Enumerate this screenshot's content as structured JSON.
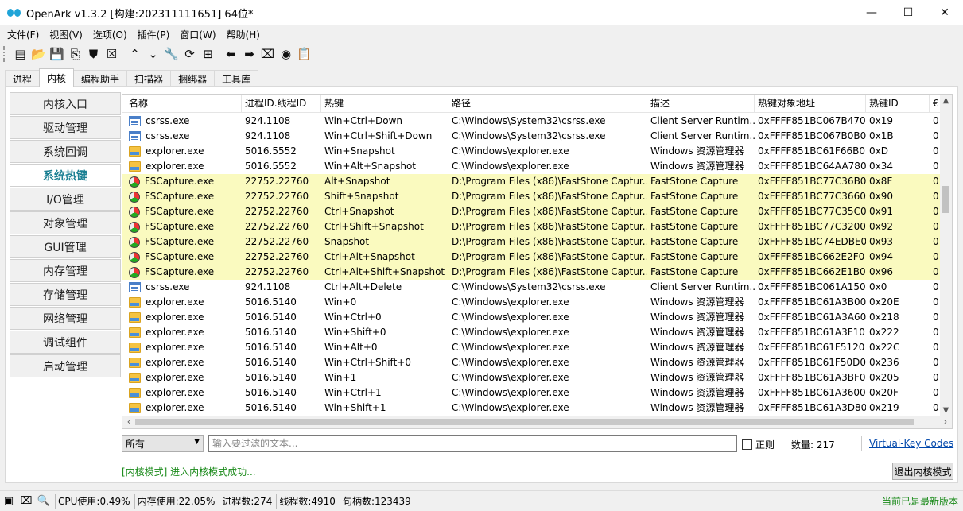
{
  "window": {
    "title": "OpenArk v1.3.2 [构建:202311111651]  64位*",
    "controls": [
      "—",
      "☐",
      "✕"
    ]
  },
  "menu": [
    "文件(F)",
    "视图(V)",
    "选项(O)",
    "插件(P)",
    "窗口(W)",
    "帮助(H)"
  ],
  "toolbar": [
    {
      "name": "console-icon",
      "glyph": "▤"
    },
    {
      "name": "folder-open-icon",
      "glyph": "📂"
    },
    {
      "name": "save-icon",
      "glyph": "💾"
    },
    {
      "name": "export-icon",
      "glyph": "⎘"
    },
    {
      "name": "shield-icon",
      "glyph": "⛊"
    },
    {
      "name": "kill-icon",
      "glyph": "☒"
    },
    {
      "name": "chevron-up-icon",
      "glyph": "⌃"
    },
    {
      "name": "chevron-down-icon",
      "glyph": "⌄"
    },
    {
      "name": "wrench-icon",
      "glyph": "🔧"
    },
    {
      "name": "refresh-icon",
      "glyph": "⟳"
    },
    {
      "name": "grid-icon",
      "glyph": "⊞"
    },
    {
      "name": "arrow-left-icon",
      "glyph": "⬅"
    },
    {
      "name": "arrow-right-icon",
      "glyph": "➡"
    },
    {
      "name": "map-icon",
      "glyph": "⌧"
    },
    {
      "name": "github-icon",
      "glyph": "◉"
    },
    {
      "name": "clipboard-icon",
      "glyph": "📋"
    }
  ],
  "tabs": [
    "进程",
    "内核",
    "编程助手",
    "扫描器",
    "捆绑器",
    "工具库"
  ],
  "active_tab": 1,
  "sidenav": [
    "内核入口",
    "驱动管理",
    "系统回调",
    "系统热键",
    "I/O管理",
    "对象管理",
    "GUI管理",
    "内存管理",
    "存储管理",
    "网络管理",
    "调试组件",
    "启动管理"
  ],
  "active_nav": 3,
  "table": {
    "columns": [
      "名称",
      "进程ID.线程ID",
      "热键",
      "路径",
      "描述",
      "热键对象地址",
      "热键ID",
      "€"
    ],
    "rows": [
      {
        "icon": "win",
        "hl": false,
        "c": [
          "csrss.exe",
          "924.1108",
          "Win+Ctrl+Down",
          "C:\\Windows\\System32\\csrss.exe",
          "Client Server Runtim...",
          "0xFFFF851BC067B470",
          "0x19",
          "0"
        ]
      },
      {
        "icon": "win",
        "hl": false,
        "c": [
          "csrss.exe",
          "924.1108",
          "Win+Ctrl+Shift+Down",
          "C:\\Windows\\System32\\csrss.exe",
          "Client Server Runtim...",
          "0xFFFF851BC067B0B0",
          "0x1B",
          "0"
        ]
      },
      {
        "icon": "folder",
        "hl": false,
        "c": [
          "explorer.exe",
          "5016.5552",
          "Win+Snapshot",
          "C:\\Windows\\explorer.exe",
          "Windows 资源管理器",
          "0xFFFF851BC61F66B0",
          "0xD",
          "0"
        ]
      },
      {
        "icon": "folder",
        "hl": false,
        "c": [
          "explorer.exe",
          "5016.5552",
          "Win+Alt+Snapshot",
          "C:\\Windows\\explorer.exe",
          "Windows 资源管理器",
          "0xFFFF851BC64AA780",
          "0x34",
          "0"
        ]
      },
      {
        "icon": "fs",
        "hl": true,
        "c": [
          "FSCapture.exe",
          "22752.22760",
          "Alt+Snapshot",
          "D:\\Program Files (x86)\\FastStone Captur...",
          "FastStone Capture",
          "0xFFFF851BC77C36B0",
          "0x8F",
          "0"
        ]
      },
      {
        "icon": "fs",
        "hl": true,
        "c": [
          "FSCapture.exe",
          "22752.22760",
          "Shift+Snapshot",
          "D:\\Program Files (x86)\\FastStone Captur...",
          "FastStone Capture",
          "0xFFFF851BC77C3660",
          "0x90",
          "0"
        ]
      },
      {
        "icon": "fs",
        "hl": true,
        "c": [
          "FSCapture.exe",
          "22752.22760",
          "Ctrl+Snapshot",
          "D:\\Program Files (x86)\\FastStone Captur...",
          "FastStone Capture",
          "0xFFFF851BC77C35C0",
          "0x91",
          "0"
        ]
      },
      {
        "icon": "fs",
        "hl": true,
        "c": [
          "FSCapture.exe",
          "22752.22760",
          "Ctrl+Shift+Snapshot",
          "D:\\Program Files (x86)\\FastStone Captur...",
          "FastStone Capture",
          "0xFFFF851BC77C3200",
          "0x92",
          "0"
        ]
      },
      {
        "icon": "fs",
        "hl": true,
        "c": [
          "FSCapture.exe",
          "22752.22760",
          "Snapshot",
          "D:\\Program Files (x86)\\FastStone Captur...",
          "FastStone Capture",
          "0xFFFF851BC74EDBE0",
          "0x93",
          "0"
        ]
      },
      {
        "icon": "fs",
        "hl": true,
        "c": [
          "FSCapture.exe",
          "22752.22760",
          "Ctrl+Alt+Snapshot",
          "D:\\Program Files (x86)\\FastStone Captur...",
          "FastStone Capture",
          "0xFFFF851BC662E2F0",
          "0x94",
          "0"
        ]
      },
      {
        "icon": "fs",
        "hl": true,
        "c": [
          "FSCapture.exe",
          "22752.22760",
          "Ctrl+Alt+Shift+Snapshot",
          "D:\\Program Files (x86)\\FastStone Captur...",
          "FastStone Capture",
          "0xFFFF851BC662E1B0",
          "0x96",
          "0"
        ]
      },
      {
        "icon": "win",
        "hl": false,
        "c": [
          "csrss.exe",
          "924.1108",
          "Ctrl+Alt+Delete",
          "C:\\Windows\\System32\\csrss.exe",
          "Client Server Runtim...",
          "0xFFFF851BC061A150",
          "0x0",
          "0"
        ]
      },
      {
        "icon": "folder",
        "hl": false,
        "c": [
          "explorer.exe",
          "5016.5140",
          "Win+0",
          "C:\\Windows\\explorer.exe",
          "Windows 资源管理器",
          "0xFFFF851BC61A3B00",
          "0x20E",
          "0"
        ]
      },
      {
        "icon": "folder",
        "hl": false,
        "c": [
          "explorer.exe",
          "5016.5140",
          "Win+Ctrl+0",
          "C:\\Windows\\explorer.exe",
          "Windows 资源管理器",
          "0xFFFF851BC61A3A60",
          "0x218",
          "0"
        ]
      },
      {
        "icon": "folder",
        "hl": false,
        "c": [
          "explorer.exe",
          "5016.5140",
          "Win+Shift+0",
          "C:\\Windows\\explorer.exe",
          "Windows 资源管理器",
          "0xFFFF851BC61A3F10",
          "0x222",
          "0"
        ]
      },
      {
        "icon": "folder",
        "hl": false,
        "c": [
          "explorer.exe",
          "5016.5140",
          "Win+Alt+0",
          "C:\\Windows\\explorer.exe",
          "Windows 资源管理器",
          "0xFFFF851BC61F5120",
          "0x22C",
          "0"
        ]
      },
      {
        "icon": "folder",
        "hl": false,
        "c": [
          "explorer.exe",
          "5016.5140",
          "Win+Ctrl+Shift+0",
          "C:\\Windows\\explorer.exe",
          "Windows 资源管理器",
          "0xFFFF851BC61F50D0",
          "0x236",
          "0"
        ]
      },
      {
        "icon": "folder",
        "hl": false,
        "c": [
          "explorer.exe",
          "5016.5140",
          "Win+1",
          "C:\\Windows\\explorer.exe",
          "Windows 资源管理器",
          "0xFFFF851BC61A3BF0",
          "0x205",
          "0"
        ]
      },
      {
        "icon": "folder",
        "hl": false,
        "c": [
          "explorer.exe",
          "5016.5140",
          "Win+Ctrl+1",
          "C:\\Windows\\explorer.exe",
          "Windows 资源管理器",
          "0xFFFF851BC61A3600",
          "0x20F",
          "0"
        ]
      },
      {
        "icon": "folder",
        "hl": false,
        "c": [
          "explorer.exe",
          "5016.5140",
          "Win+Shift+1",
          "C:\\Windows\\explorer.exe",
          "Windows 资源管理器",
          "0xFFFF851BC61A3D80",
          "0x219",
          "0"
        ]
      }
    ]
  },
  "filter": {
    "select_value": "所有",
    "placeholder": "输入要过滤的文本...",
    "regex_label": "正则",
    "count_label": "数量:  217",
    "vk_link": "Virtual-Key Codes"
  },
  "status_msg": "[内核模式] 进入内核模式成功...",
  "exit_button": "退出内核模式",
  "statusbar": {
    "cpu": "CPU使用:0.49%",
    "mem": "内存使用:22.05%",
    "proc": "进程数:274",
    "thread": "线程数:4910",
    "handle": "句柄数:123439",
    "update": "当前已是最新版本"
  },
  "colors": {
    "highlight_row": "#fafabf",
    "active_nav_text": "#1a7f92",
    "status_green": "#1a8a1a",
    "link_blue": "#0047ab"
  }
}
